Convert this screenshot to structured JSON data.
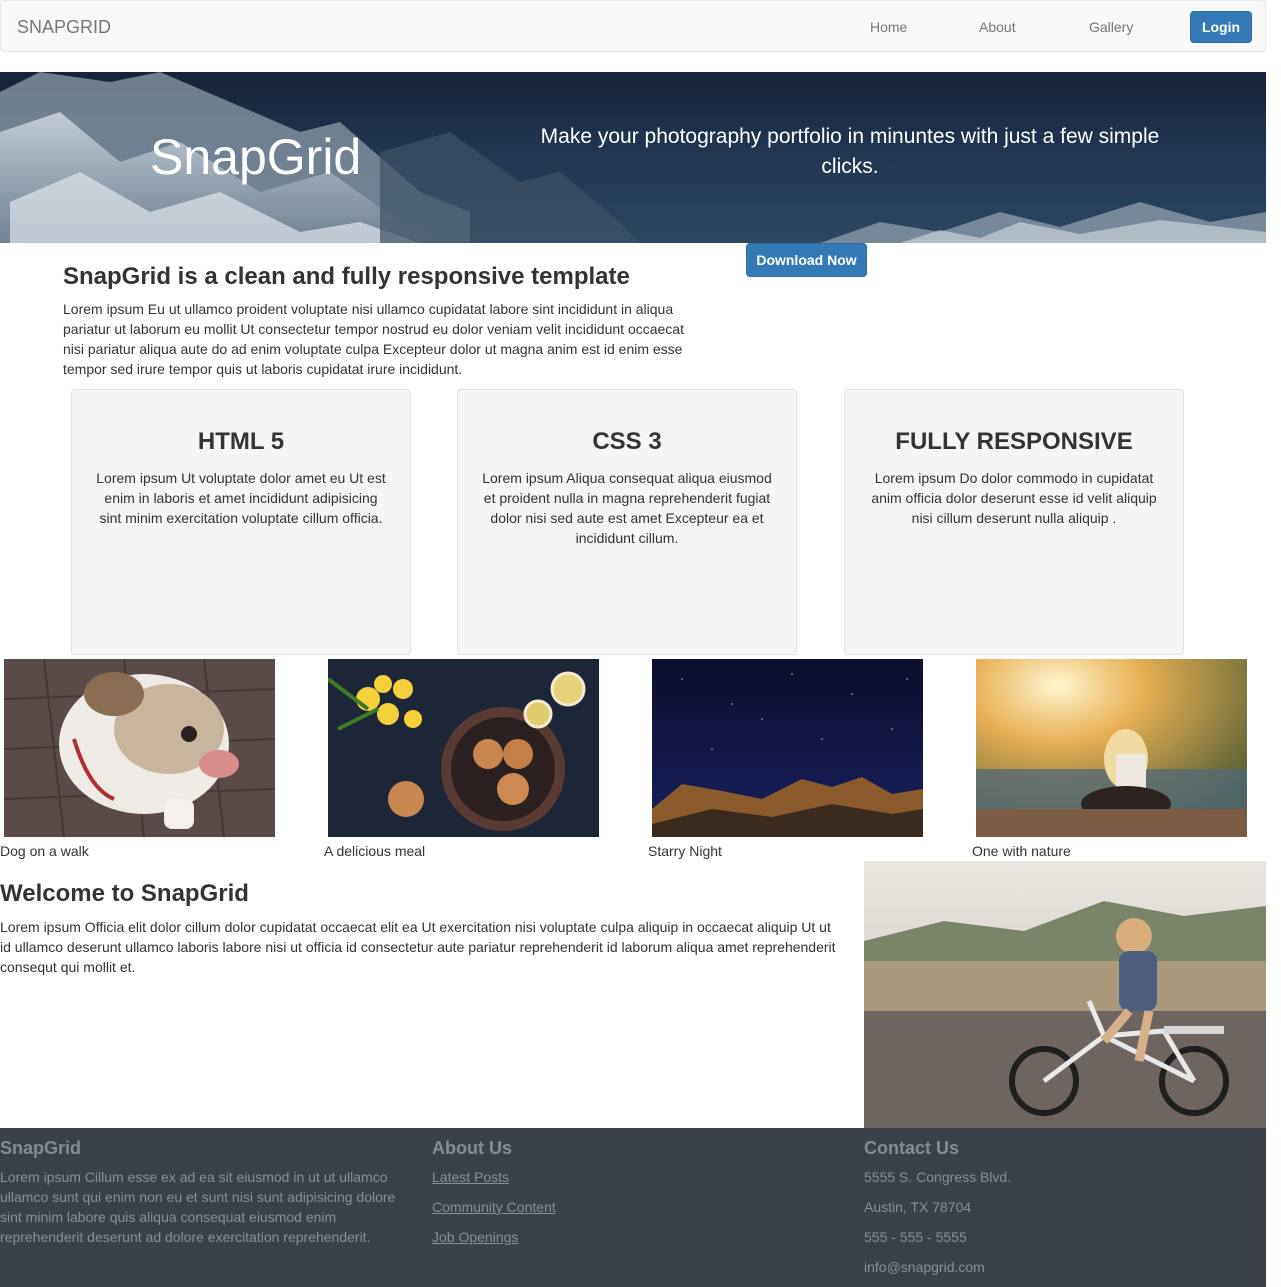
{
  "navbar": {
    "brand": "SNAPGRID",
    "links": [
      "Home",
      "About",
      "Gallery"
    ],
    "login_label": "Login"
  },
  "hero": {
    "title": "SnapGrid",
    "tagline": "Make your photography portfolio in minuntes with just a few simple clicks.",
    "download_label": "Download Now"
  },
  "intro": {
    "heading": "SnapGrid is a clean and fully responsive template",
    "text": "Lorem ipsum Eu ut ullamco proident voluptate nisi ullamco cupidatat labore sint incididunt in aliqua pariatur ut laborum eu mollit Ut consectetur tempor nostrud eu dolor veniam velit incididunt occaecat nisi pariatur aliqua aute do ad enim voluptate culpa Excepteur dolor ut magna anim est id enim esse tempor sed irure tempor quis ut laboris cupidatat irure incididunt."
  },
  "features": [
    {
      "title": "HTML 5",
      "text": "Lorem ipsum Ut voluptate dolor amet eu Ut est enim in laboris et amet incididunt adipisicing sint minim exercitation voluptate cillum officia."
    },
    {
      "title": "CSS 3",
      "text": "Lorem ipsum Aliqua consequat aliqua eiusmod et proident nulla in magna reprehenderit fugiat dolor nisi sed aute est amet Excepteur ea et incididunt cillum."
    },
    {
      "title": "FULLY RESPONSIVE",
      "text": "Lorem ipsum Do dolor commodo in cupidatat anim officia dolor deserunt esse id velit aliquip nisi cillum deserunt nulla aliquip ."
    }
  ],
  "gallery": [
    {
      "caption": "Dog on a walk"
    },
    {
      "caption": "A delicious meal"
    },
    {
      "caption": "Starry Night"
    },
    {
      "caption": "One with nature"
    }
  ],
  "welcome": {
    "heading": "Welcome to SnapGrid",
    "text": "Lorem ipsum Officia elit dolor cillum dolor cupidatat occaecat elit ea Ut exercitation nisi voluptate culpa aliquip in occaecat aliquip Ut ut id ullamco deserunt ullamco laboris labore nisi ut officia id consectetur aute pariatur reprehenderit id laborum aliqua amet reprehenderit consequt qui mollit et."
  },
  "footer": {
    "about_col": {
      "heading": "SnapGrid",
      "text": "Lorem ipsum Cillum esse ex ad ea sit eiusmod in ut ut ullamco ullamco sunt qui enim non eu et sunt nisi sunt adipisicing dolore sint minim labore quis aliqua consequat eiusmod enim reprehenderit deserunt ad dolore exercitation reprehenderit."
    },
    "links_col": {
      "heading": "About Us",
      "links": [
        "Latest Posts",
        "Community Content",
        "Job Openings"
      ]
    },
    "contact_col": {
      "heading": "Contact Us",
      "lines": [
        "5555 S. Congress Blvd.",
        "Austin, TX 78704",
        "555 - 555 - 5555",
        "info@snapgrid.com"
      ]
    }
  },
  "colors": {
    "primary_button": "#337ab7",
    "navbar_bg": "#f8f8f8",
    "card_bg": "#f5f5f5",
    "footer_bg": "#3a414a"
  }
}
